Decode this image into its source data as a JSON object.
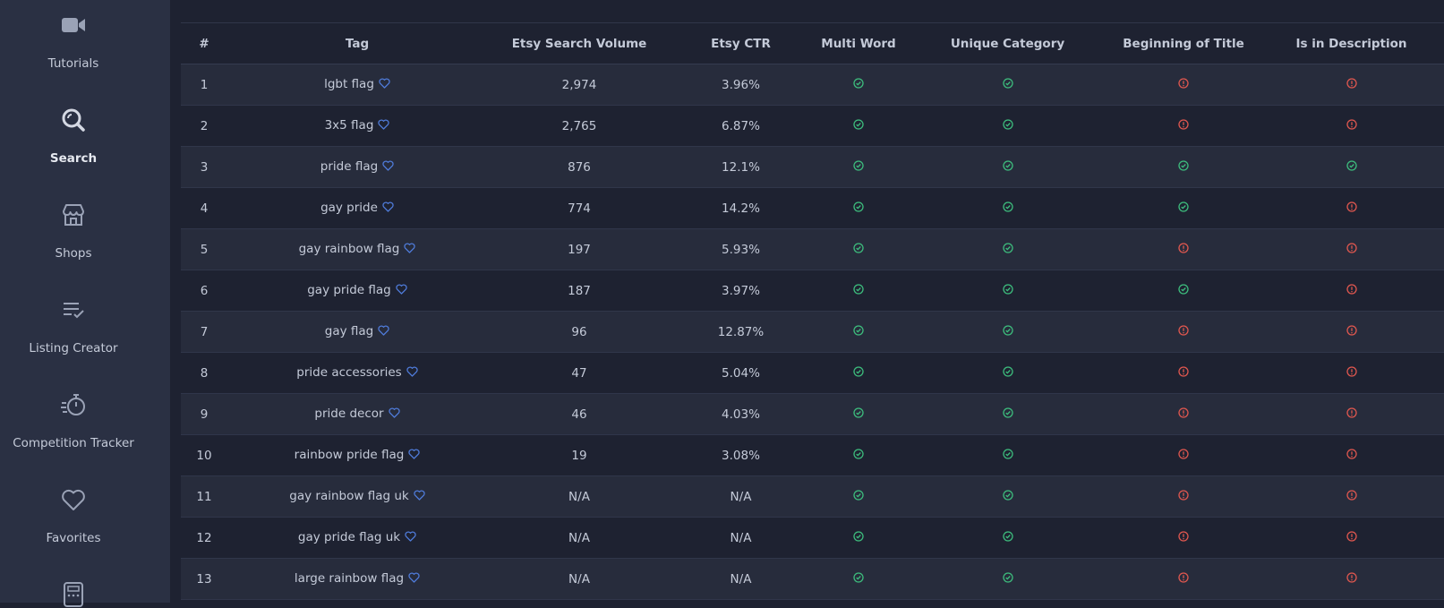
{
  "sidebar": {
    "items": [
      {
        "label": "Tutorials",
        "icon": "video-camera-icon",
        "active": false
      },
      {
        "label": "Search",
        "icon": "search-icon",
        "active": true
      },
      {
        "label": "Shops",
        "icon": "store-icon",
        "active": false
      },
      {
        "label": "Listing Creator",
        "icon": "list-check-icon",
        "active": false
      },
      {
        "label": "Competition Tracker",
        "icon": "stopwatch-icon",
        "active": false
      },
      {
        "label": "Favorites",
        "icon": "heart-icon",
        "active": false
      },
      {
        "label": "",
        "icon": "calculator-icon",
        "active": false
      }
    ]
  },
  "table": {
    "headers": [
      "#",
      "Tag",
      "Etsy Search Volume",
      "Etsy CTR",
      "Multi Word",
      "Unique Category",
      "Beginning of Title",
      "Is in Description"
    ],
    "rows": [
      {
        "num": "1",
        "tag": "lgbt flag",
        "volume": "2,974",
        "ctr": "3.96%",
        "multi_word": true,
        "unique_category": true,
        "beginning_of_title": false,
        "in_description": false
      },
      {
        "num": "2",
        "tag": "3x5 flag",
        "volume": "2,765",
        "ctr": "6.87%",
        "multi_word": true,
        "unique_category": true,
        "beginning_of_title": false,
        "in_description": false
      },
      {
        "num": "3",
        "tag": "pride flag",
        "volume": "876",
        "ctr": "12.1%",
        "multi_word": true,
        "unique_category": true,
        "beginning_of_title": true,
        "in_description": true
      },
      {
        "num": "4",
        "tag": "gay pride",
        "volume": "774",
        "ctr": "14.2%",
        "multi_word": true,
        "unique_category": true,
        "beginning_of_title": true,
        "in_description": false
      },
      {
        "num": "5",
        "tag": "gay rainbow flag",
        "volume": "197",
        "ctr": "5.93%",
        "multi_word": true,
        "unique_category": true,
        "beginning_of_title": false,
        "in_description": false
      },
      {
        "num": "6",
        "tag": "gay pride flag",
        "volume": "187",
        "ctr": "3.97%",
        "multi_word": true,
        "unique_category": true,
        "beginning_of_title": true,
        "in_description": false
      },
      {
        "num": "7",
        "tag": "gay flag",
        "volume": "96",
        "ctr": "12.87%",
        "multi_word": true,
        "unique_category": true,
        "beginning_of_title": false,
        "in_description": false
      },
      {
        "num": "8",
        "tag": "pride accessories",
        "volume": "47",
        "ctr": "5.04%",
        "multi_word": true,
        "unique_category": true,
        "beginning_of_title": false,
        "in_description": false
      },
      {
        "num": "9",
        "tag": "pride decor",
        "volume": "46",
        "ctr": "4.03%",
        "multi_word": true,
        "unique_category": true,
        "beginning_of_title": false,
        "in_description": false
      },
      {
        "num": "10",
        "tag": "rainbow pride flag",
        "volume": "19",
        "ctr": "3.08%",
        "multi_word": true,
        "unique_category": true,
        "beginning_of_title": false,
        "in_description": false
      },
      {
        "num": "11",
        "tag": "gay rainbow flag uk",
        "volume": "N/A",
        "ctr": "N/A",
        "multi_word": true,
        "unique_category": true,
        "beginning_of_title": false,
        "in_description": false
      },
      {
        "num": "12",
        "tag": "gay pride flag uk",
        "volume": "N/A",
        "ctr": "N/A",
        "multi_word": true,
        "unique_category": true,
        "beginning_of_title": false,
        "in_description": false
      },
      {
        "num": "13",
        "tag": "large rainbow flag",
        "volume": "N/A",
        "ctr": "N/A",
        "multi_word": true,
        "unique_category": true,
        "beginning_of_title": false,
        "in_description": false
      }
    ]
  },
  "colors": {
    "check": "#3dbd7d",
    "alert": "#e0574f",
    "heart": "#4f7bd9",
    "sidebar_icon": "#9aa2b6"
  }
}
